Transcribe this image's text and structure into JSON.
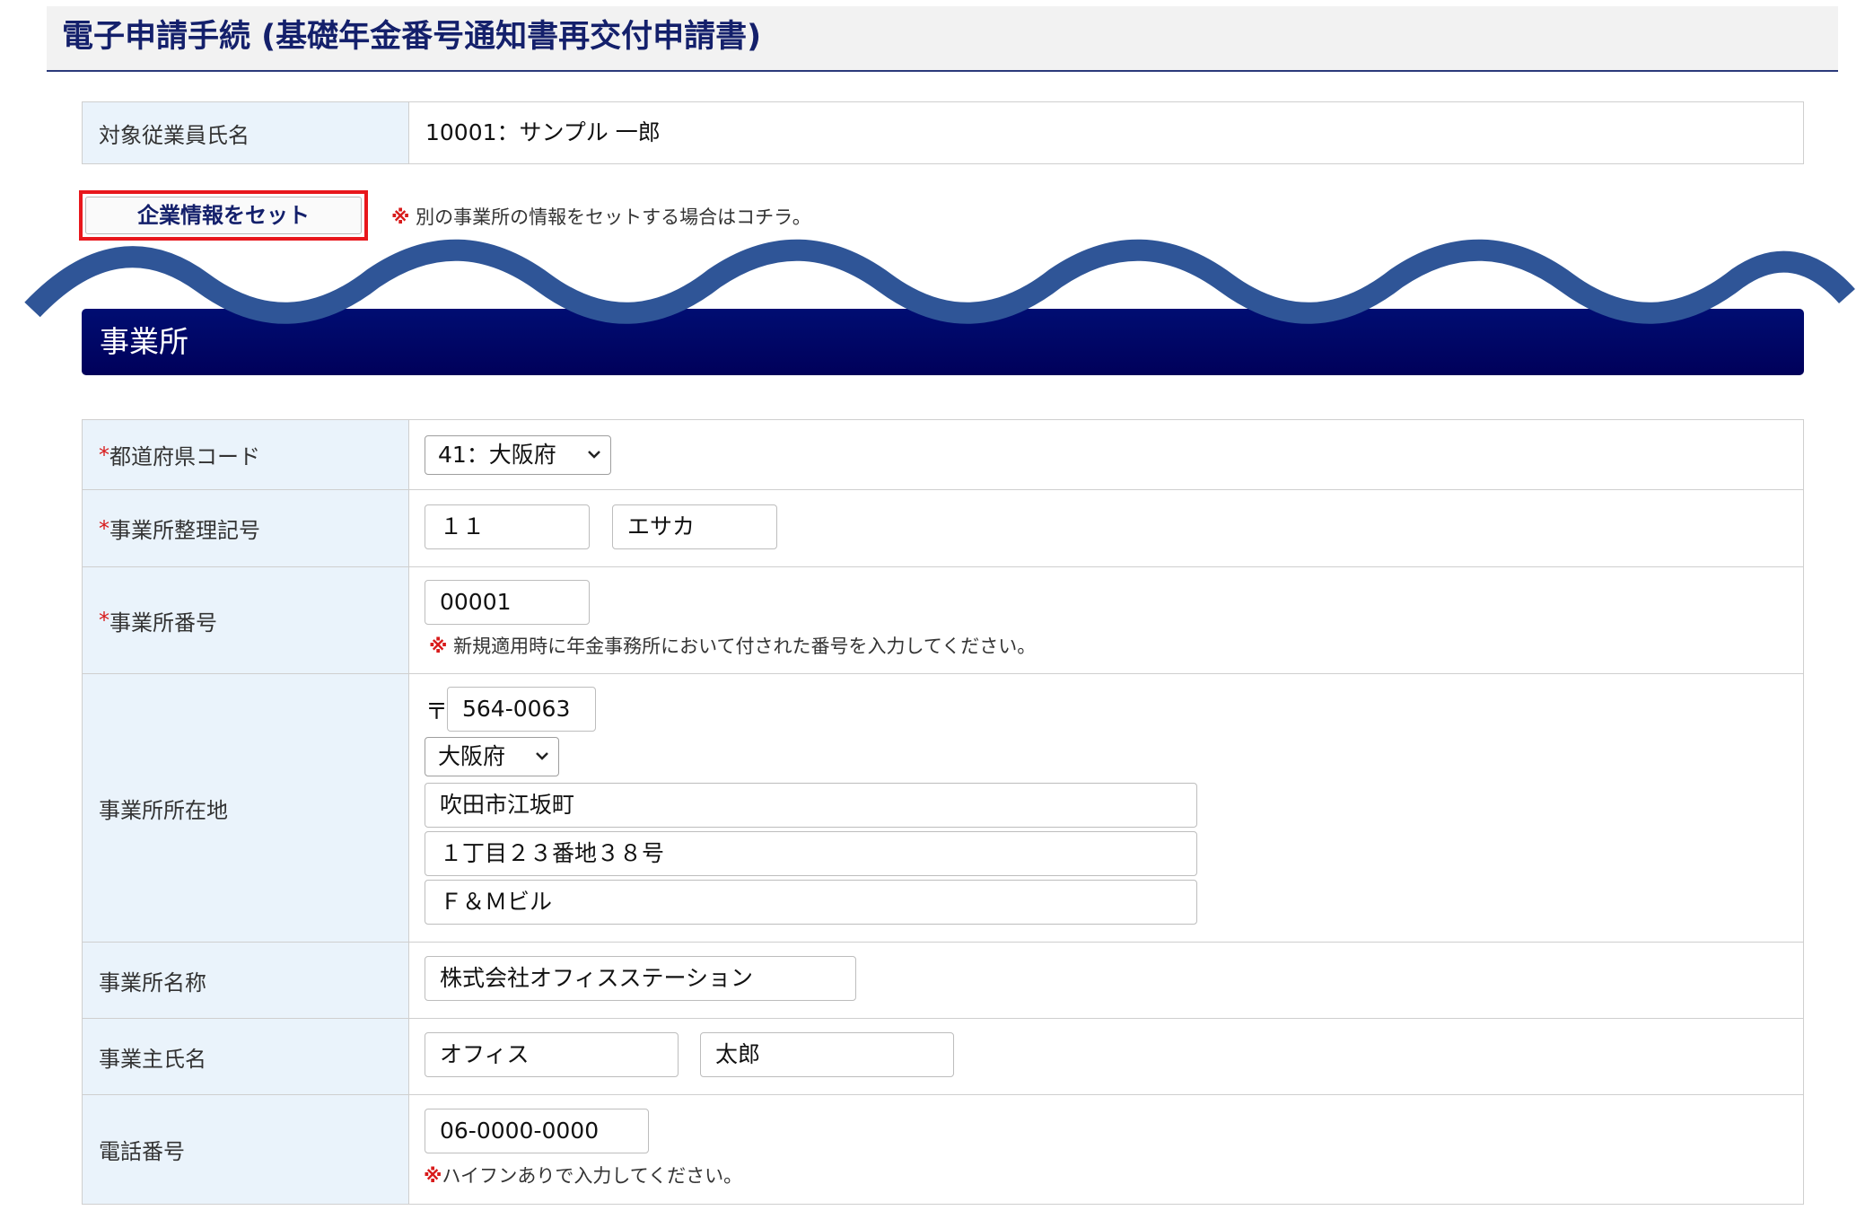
{
  "page": {
    "title": "電子申請手続 (基礎年金番号通知書再交付申請書)"
  },
  "employee": {
    "label": "対象従業員氏名",
    "value": "10001：サンプル 一郎"
  },
  "set_company": {
    "button_label": "企業情報をセット",
    "note_mark": "※",
    "note_text": "別の事業所の情報をセットする場合はコチラ。"
  },
  "section": {
    "title": "事業所"
  },
  "form": {
    "required_mark": "*",
    "note_mark": "※",
    "prefecture_code": {
      "label": "都道府県コード",
      "value": "41：大阪府"
    },
    "office_symbol": {
      "label": "事業所整理記号",
      "value1": "１１",
      "value2": "エサカ"
    },
    "office_number": {
      "label": "事業所番号",
      "value": "00001",
      "note": "新規適用時に年金事務所において付された番号を入力してください。"
    },
    "address": {
      "label": "事業所所在地",
      "postal_mark": "〒",
      "postal_code": "564-0063",
      "prefecture": "大阪府",
      "line1": "吹田市江坂町",
      "line2": "１丁目２３番地３８号",
      "line3": "Ｆ＆Ｍビル"
    },
    "office_name": {
      "label": "事業所名称",
      "value": "株式会社オフィスステーション"
    },
    "owner_name": {
      "label": "事業主氏名",
      "last": "オフィス",
      "first": "太郎"
    },
    "phone": {
      "label": "電話番号",
      "value": "06-0000-0000",
      "note": "ハイフンありで入力してください。"
    }
  },
  "colors": {
    "title_text": "#14206b",
    "section_header": "#00006a",
    "highlight_border": "#e8171c",
    "wave": "#2f5597",
    "required": "#d81b1b",
    "label_bg": "#eaf3fb"
  },
  "icons": {
    "select_arrow": "chevron-down-icon",
    "decoration": "wave-divider"
  }
}
